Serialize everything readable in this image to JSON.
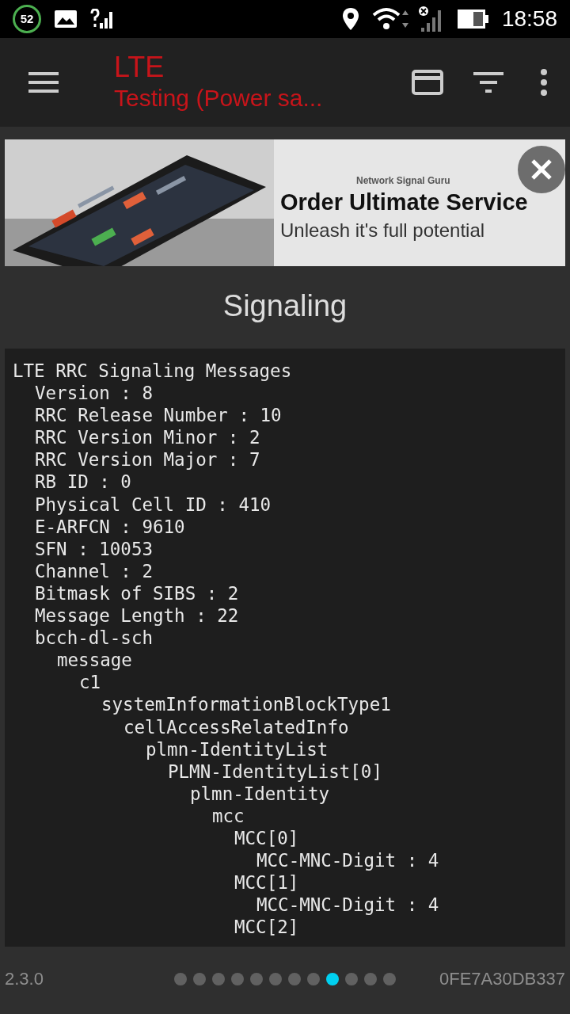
{
  "status_bar": {
    "badge": "52",
    "time": "18:58"
  },
  "app_bar": {
    "title": "LTE",
    "subtitle": "Testing (Power sa..."
  },
  "banner": {
    "brand": "Network Signal Guru",
    "headline": "Order Ultimate Service",
    "tagline": "Unleash it's full potential"
  },
  "page_title": "Signaling",
  "message_tree": [
    {
      "text": "LTE RRC Signaling Messages",
      "children": [
        {
          "text": "Version : 8"
        },
        {
          "text": "RRC Release Number : 10"
        },
        {
          "text": "RRC Version Minor : 2"
        },
        {
          "text": "RRC Version Major : 7"
        },
        {
          "text": "RB ID : 0"
        },
        {
          "text": "Physical Cell ID : 410"
        },
        {
          "text": "E-ARFCN : 9610"
        },
        {
          "text": "SFN : 10053"
        },
        {
          "text": "Channel : 2"
        },
        {
          "text": "Bitmask of SIBS : 2"
        },
        {
          "text": "Message Length : 22"
        },
        {
          "text": "bcch-dl-sch",
          "children": [
            {
              "text": "message",
              "children": [
                {
                  "text": "c1",
                  "children": [
                    {
                      "text": "systemInformationBlockType1",
                      "children": [
                        {
                          "text": "cellAccessRelatedInfo",
                          "children": [
                            {
                              "text": "plmn-IdentityList",
                              "children": [
                                {
                                  "text": "PLMN-IdentityList[0]",
                                  "children": [
                                    {
                                      "text": "plmn-Identity",
                                      "children": [
                                        {
                                          "text": "mcc",
                                          "children": [
                                            {
                                              "text": "MCC[0]",
                                              "children": [
                                                {
                                                  "text": "MCC-MNC-Digit : 4"
                                                }
                                              ]
                                            },
                                            {
                                              "text": "MCC[1]",
                                              "children": [
                                                {
                                                  "text": "MCC-MNC-Digit : 4"
                                                }
                                              ]
                                            },
                                            {
                                              "text": "MCC[2]"
                                            }
                                          ]
                                        }
                                      ]
                                    }
                                  ]
                                }
                              ]
                            }
                          ]
                        }
                      ]
                    }
                  ]
                }
              ]
            }
          ]
        }
      ]
    }
  ],
  "footer": {
    "version": "2.3.0",
    "device_id": "0FE7A30DB337"
  },
  "pager_dots": [
    {
      "selected": false
    },
    {
      "selected": false
    },
    {
      "selected": false
    },
    {
      "selected": false
    },
    {
      "selected": false
    },
    {
      "selected": false
    },
    {
      "selected": false
    },
    {
      "selected": false
    },
    {
      "selected": true
    },
    {
      "selected": false
    },
    {
      "selected": false
    },
    {
      "selected": false
    }
  ]
}
